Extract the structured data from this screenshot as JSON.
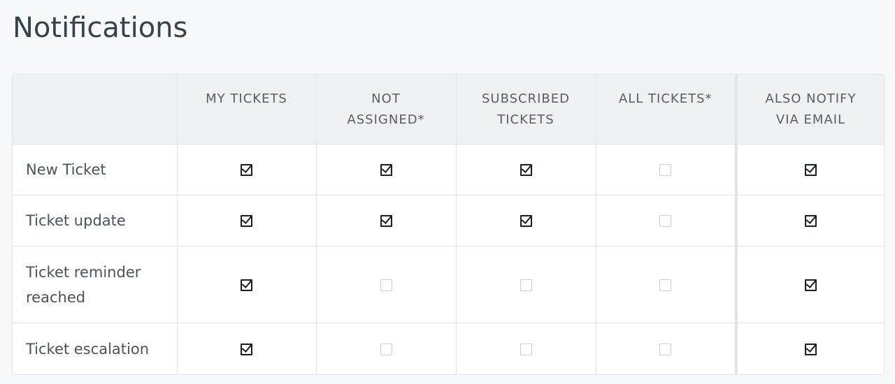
{
  "page": {
    "title": "Notifications"
  },
  "table": {
    "columns": [
      {
        "key": "label",
        "line1": "",
        "line2": ""
      },
      {
        "key": "my_tickets",
        "line1": "MY TICKETS",
        "line2": ""
      },
      {
        "key": "not_assigned",
        "line1": "NOT",
        "line2": "ASSIGNED*"
      },
      {
        "key": "subscribed_tickets",
        "line1": "SUBSCRIBED",
        "line2": "TICKETS"
      },
      {
        "key": "all_tickets",
        "line1": "ALL TICKETS*",
        "line2": ""
      },
      {
        "key": "also_notify_email",
        "line1": "ALSO NOTIFY",
        "line2": "VIA EMAIL"
      }
    ],
    "rows": [
      {
        "label": "New Ticket",
        "my_tickets": true,
        "not_assigned": true,
        "subscribed_tickets": true,
        "all_tickets": false,
        "also_notify_email": true
      },
      {
        "label": "Ticket update",
        "my_tickets": true,
        "not_assigned": true,
        "subscribed_tickets": true,
        "all_tickets": false,
        "also_notify_email": true
      },
      {
        "label": "Ticket reminder reached",
        "my_tickets": true,
        "not_assigned": false,
        "subscribed_tickets": false,
        "all_tickets": false,
        "also_notify_email": true
      },
      {
        "label": "Ticket escalation",
        "my_tickets": true,
        "not_assigned": false,
        "subscribed_tickets": false,
        "all_tickets": false,
        "also_notify_email": true
      }
    ]
  },
  "icons": {
    "checked": "checkbox-checked-icon",
    "unchecked": "checkbox-unchecked-icon"
  },
  "colors": {
    "background": "#f6f8fa",
    "header_background": "#eef1f2",
    "border": "#dfe4e7",
    "text": "#38414a",
    "check": "#1b1f23"
  }
}
